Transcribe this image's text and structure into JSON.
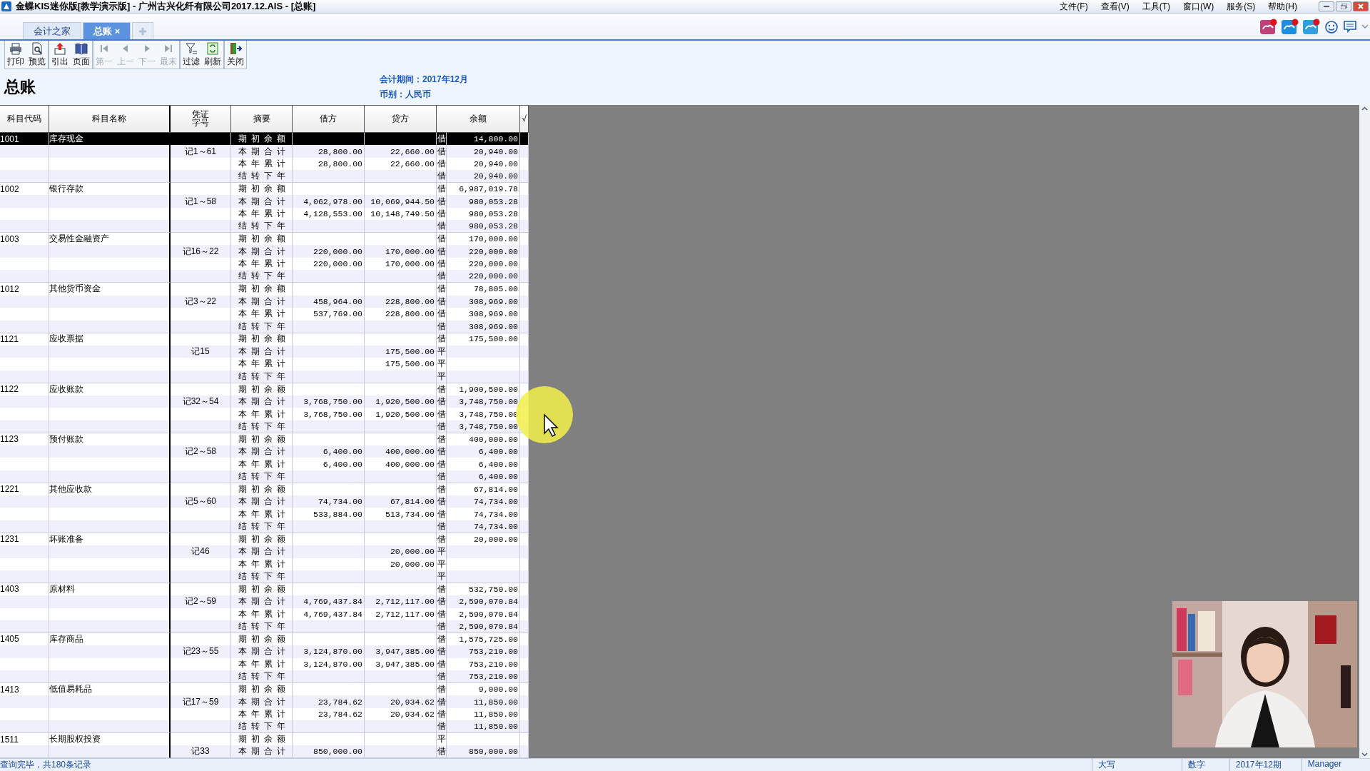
{
  "window": {
    "title": "金蝶KIS迷你版[教学演示版] - 广州古兴化纤有限公司2017.12.AIS - [总账]"
  },
  "menu": [
    "文件(F)",
    "查看(V)",
    "工具(T)",
    "窗口(W)",
    "服务(S)",
    "帮助(H)"
  ],
  "tabs": [
    {
      "label": "会计之家",
      "selected": false
    },
    {
      "label": "总账",
      "selected": true,
      "close": "×"
    }
  ],
  "toolbar": [
    {
      "kind": "print",
      "label": "打印",
      "disabled": false
    },
    {
      "kind": "preview",
      "label": "预览",
      "disabled": false
    },
    {
      "kind": "export",
      "label": "引出",
      "disabled": false
    },
    {
      "kind": "page",
      "label": "页面",
      "disabled": false
    },
    {
      "kind": "first",
      "label": "第一",
      "disabled": true
    },
    {
      "kind": "prev",
      "label": "上一",
      "disabled": true
    },
    {
      "kind": "next",
      "label": "下一",
      "disabled": true
    },
    {
      "kind": "last",
      "label": "最末",
      "disabled": true
    },
    {
      "kind": "filter",
      "label": "过滤",
      "disabled": false
    },
    {
      "kind": "refresh",
      "label": "刷新",
      "disabled": false
    },
    {
      "kind": "close",
      "label": "关闭",
      "disabled": false
    }
  ],
  "report": {
    "title": "总账",
    "period": "会计期间：2017年12月",
    "currency": "币别：人民币"
  },
  "table": {
    "columns": [
      "科目代码",
      "科目名称",
      "凭证字号",
      "摘要",
      "借方",
      "贷方",
      "余额",
      "√"
    ],
    "accounts": [
      {
        "code": "1001",
        "name": "库存现金",
        "voucher": "记1～61",
        "lines": [
          {
            "summary": "期初余额",
            "direction": "借",
            "balance": "14,800.00",
            "selected": true
          },
          {
            "summary": "本期合计",
            "debit": "28,800.00",
            "credit": "22,660.00",
            "direction": "借",
            "balance": "20,940.00",
            "selected": false
          },
          {
            "summary": "本年累计",
            "debit": "28,800.00",
            "credit": "22,660.00",
            "direction": "借",
            "balance": "20,940.00",
            "selected": false
          },
          {
            "summary": "结转下年",
            "direction": "借",
            "balance": "20,940.00",
            "selected": false
          }
        ]
      },
      {
        "code": "1002",
        "name": "银行存款",
        "voucher": "记1～58",
        "lines": [
          {
            "summary": "期初余额",
            "direction": "借",
            "balance": "6,987,019.78",
            "selected": false
          },
          {
            "summary": "本期合计",
            "debit": "4,062,978.00",
            "credit": "10,069,944.50",
            "direction": "借",
            "balance": "980,053.28",
            "selected": false
          },
          {
            "summary": "本年累计",
            "debit": "4,128,553.00",
            "credit": "10,148,749.50",
            "direction": "借",
            "balance": "980,053.28",
            "selected": false
          },
          {
            "summary": "结转下年",
            "direction": "借",
            "balance": "980,053.28",
            "selected": false
          }
        ]
      },
      {
        "code": "1003",
        "name": "交易性金融资产",
        "voucher": "记16～22",
        "lines": [
          {
            "summary": "期初余额",
            "direction": "借",
            "balance": "170,000.00",
            "selected": false
          },
          {
            "summary": "本期合计",
            "debit": "220,000.00",
            "credit": "170,000.00",
            "direction": "借",
            "balance": "220,000.00",
            "selected": false
          },
          {
            "summary": "本年累计",
            "debit": "220,000.00",
            "credit": "170,000.00",
            "direction": "借",
            "balance": "220,000.00",
            "selected": false
          },
          {
            "summary": "结转下年",
            "direction": "借",
            "balance": "220,000.00",
            "selected": false
          }
        ]
      },
      {
        "code": "1012",
        "name": "其他货币资金",
        "voucher": "记3～22",
        "lines": [
          {
            "summary": "期初余额",
            "direction": "借",
            "balance": "78,805.00",
            "selected": false
          },
          {
            "summary": "本期合计",
            "debit": "458,964.00",
            "credit": "228,800.00",
            "direction": "借",
            "balance": "308,969.00",
            "selected": false
          },
          {
            "summary": "本年累计",
            "debit": "537,769.00",
            "credit": "228,800.00",
            "direction": "借",
            "balance": "308,969.00",
            "selected": false
          },
          {
            "summary": "结转下年",
            "direction": "借",
            "balance": "308,969.00",
            "selected": false
          }
        ]
      },
      {
        "code": "1121",
        "name": "应收票据",
        "voucher": "记15",
        "lines": [
          {
            "summary": "期初余额",
            "direction": "借",
            "balance": "175,500.00",
            "selected": false
          },
          {
            "summary": "本期合计",
            "credit": "175,500.00",
            "direction": "平",
            "selected": false
          },
          {
            "summary": "本年累计",
            "credit": "175,500.00",
            "direction": "平",
            "selected": false
          },
          {
            "summary": "结转下年",
            "direction": "平",
            "selected": false
          }
        ]
      },
      {
        "code": "1122",
        "name": "应收账款",
        "voucher": "记32～54",
        "lines": [
          {
            "summary": "期初余额",
            "direction": "借",
            "balance": "1,900,500.00",
            "selected": false
          },
          {
            "summary": "本期合计",
            "debit": "3,768,750.00",
            "credit": "1,920,500.00",
            "direction": "借",
            "balance": "3,748,750.00",
            "selected": false
          },
          {
            "summary": "本年累计",
            "debit": "3,768,750.00",
            "credit": "1,920,500.00",
            "direction": "借",
            "balance": "3,748,750.00",
            "selected": false
          },
          {
            "summary": "结转下年",
            "direction": "借",
            "balance": "3,748,750.00",
            "selected": false
          }
        ]
      },
      {
        "code": "1123",
        "name": "预付账款",
        "voucher": "记2～58",
        "lines": [
          {
            "summary": "期初余额",
            "direction": "借",
            "balance": "400,000.00",
            "selected": false
          },
          {
            "summary": "本期合计",
            "debit": "6,400.00",
            "credit": "400,000.00",
            "direction": "借",
            "balance": "6,400.00",
            "selected": false
          },
          {
            "summary": "本年累计",
            "debit": "6,400.00",
            "credit": "400,000.00",
            "direction": "借",
            "balance": "6,400.00",
            "selected": false
          },
          {
            "summary": "结转下年",
            "direction": "借",
            "balance": "6,400.00",
            "selected": false
          }
        ]
      },
      {
        "code": "1221",
        "name": "其他应收款",
        "voucher": "记5～60",
        "lines": [
          {
            "summary": "期初余额",
            "direction": "借",
            "balance": "67,814.00",
            "selected": false
          },
          {
            "summary": "本期合计",
            "debit": "74,734.00",
            "credit": "67,814.00",
            "direction": "借",
            "balance": "74,734.00",
            "selected": false
          },
          {
            "summary": "本年累计",
            "debit": "533,884.00",
            "credit": "513,734.00",
            "direction": "借",
            "balance": "74,734.00",
            "selected": false
          },
          {
            "summary": "结转下年",
            "direction": "借",
            "balance": "74,734.00",
            "selected": false
          }
        ]
      },
      {
        "code": "1231",
        "name": "坏账准备",
        "voucher": "记46",
        "lines": [
          {
            "summary": "期初余额",
            "direction": "借",
            "balance": "20,000.00",
            "selected": false
          },
          {
            "summary": "本期合计",
            "credit": "20,000.00",
            "direction": "平",
            "selected": false
          },
          {
            "summary": "本年累计",
            "credit": "20,000.00",
            "direction": "平",
            "selected": false
          },
          {
            "summary": "结转下年",
            "direction": "平",
            "selected": false
          }
        ]
      },
      {
        "code": "1403",
        "name": "原材料",
        "voucher": "记2～59",
        "lines": [
          {
            "summary": "期初余额",
            "direction": "借",
            "balance": "532,750.00",
            "selected": false
          },
          {
            "summary": "本期合计",
            "debit": "4,769,437.84",
            "credit": "2,712,117.00",
            "direction": "借",
            "balance": "2,590,070.84",
            "selected": false
          },
          {
            "summary": "本年累计",
            "debit": "4,769,437.84",
            "credit": "2,712,117.00",
            "direction": "借",
            "balance": "2,590,070.84",
            "selected": false
          },
          {
            "summary": "结转下年",
            "direction": "借",
            "balance": "2,590,070.84",
            "selected": false
          }
        ]
      },
      {
        "code": "1405",
        "name": "库存商品",
        "voucher": "记23～55",
        "lines": [
          {
            "summary": "期初余额",
            "direction": "借",
            "balance": "1,575,725.00",
            "selected": false
          },
          {
            "summary": "本期合计",
            "debit": "3,124,870.00",
            "credit": "3,947,385.00",
            "direction": "借",
            "balance": "753,210.00",
            "selected": false
          },
          {
            "summary": "本年累计",
            "debit": "3,124,870.00",
            "credit": "3,947,385.00",
            "direction": "借",
            "balance": "753,210.00",
            "selected": false
          },
          {
            "summary": "结转下年",
            "direction": "借",
            "balance": "753,210.00",
            "selected": false
          }
        ]
      },
      {
        "code": "1413",
        "name": "低值易耗品",
        "voucher": "记17～59",
        "lines": [
          {
            "summary": "期初余额",
            "direction": "借",
            "balance": "9,000.00",
            "selected": false
          },
          {
            "summary": "本期合计",
            "debit": "23,784.62",
            "credit": "20,934.62",
            "direction": "借",
            "balance": "11,850.00",
            "selected": false
          },
          {
            "summary": "本年累计",
            "debit": "23,784.62",
            "credit": "20,934.62",
            "direction": "借",
            "balance": "11,850.00",
            "selected": false
          },
          {
            "summary": "结转下年",
            "direction": "借",
            "balance": "11,850.00",
            "selected": false
          }
        ]
      },
      {
        "code": "1511",
        "name": "长期股权投资",
        "voucher": "记33",
        "lines": [
          {
            "summary": "期初余额",
            "direction": "平",
            "selected": false
          },
          {
            "summary": "本期合计",
            "debit": "850,000.00",
            "direction": "借",
            "balance": "850,000.00",
            "selected": false
          }
        ]
      }
    ]
  },
  "status_bar": [
    "查询完毕，共180条记录",
    "大写",
    "数字",
    "2017年12期",
    "Manager"
  ],
  "webcam": {
    "kind": "picture"
  }
}
